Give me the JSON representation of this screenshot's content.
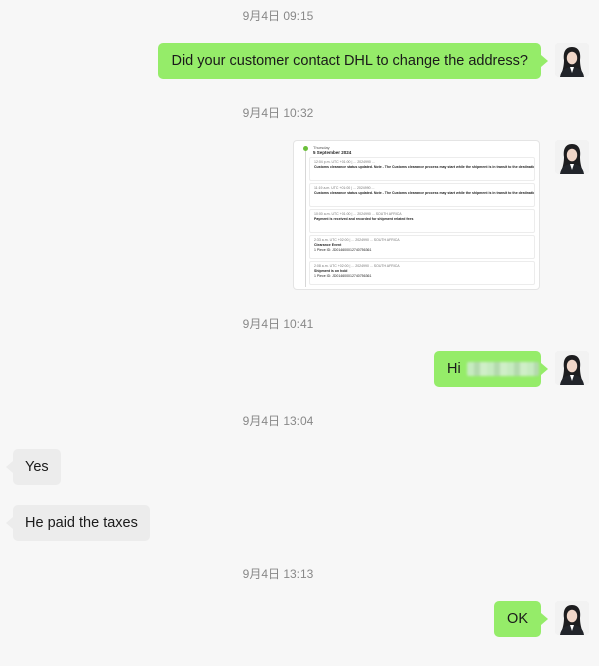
{
  "messages": [
    {
      "kind": "timestamp",
      "text": "9月4日 09:15"
    },
    {
      "kind": "outgoing",
      "text": "Did your customer contact DHL to change the address?"
    },
    {
      "kind": "timestamp",
      "text": "9月4日 10:32"
    },
    {
      "kind": "image",
      "day": "Thursday",
      "date": "5 September 2024",
      "entries": [
        {
          "meta": "12:04 p.m. UTC +01:00 | ... 2024990 ... ",
          "line1": "Customs clearance status updated. Note - The Customs clearance process may start while the shipment is in transit to the destination.",
          "line2": ""
        },
        {
          "meta": "11:19 a.m. UTC +01:00 | ... 2024990 ... ",
          "line1": "Customs clearance status updated. Note - The Customs clearance process may start while the shipment is in transit to the destination.",
          "line2": ""
        },
        {
          "meta": "10:00 a.m. UTC +01:00 | ... 2024990 ... SOUTH AFRICA",
          "line1": "Payment is received and recorded for shipment related fees",
          "line2": ""
        },
        {
          "meta": "2:33 a.m. UTC +02:00 | ... 2024990 ... SOUTH AFRICA",
          "line1": "Clearance Event",
          "line2": "1 Piece ID: JD014600012740756361"
        },
        {
          "meta": "2:08 a.m. UTC +02:00 | ... 2024990 ... SOUTH AFRICA",
          "line1": "Shipment is on hold",
          "line2": "1 Piece ID: JD014600012740756361"
        }
      ]
    },
    {
      "kind": "timestamp",
      "text": "9月4日 10:41"
    },
    {
      "kind": "outgoing",
      "text": "Hi"
    },
    {
      "kind": "timestamp",
      "text": "9月4日 13:04"
    },
    {
      "kind": "incoming",
      "text": "Yes"
    },
    {
      "kind": "incoming",
      "text": "He paid the taxes"
    },
    {
      "kind": "timestamp",
      "text": "9月4日 13:13"
    },
    {
      "kind": "outgoing",
      "text": "OK"
    }
  ]
}
